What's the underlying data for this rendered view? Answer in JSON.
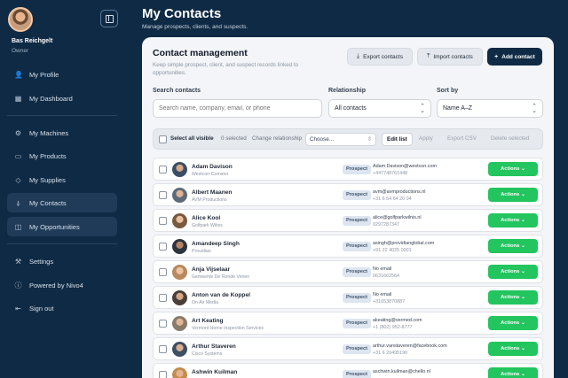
{
  "user": {
    "name": "Bas Reichgelt",
    "role": "Owner"
  },
  "sidebar": {
    "items": [
      {
        "label": "My Profile",
        "icon": "user-icon",
        "glyph": "👤"
      },
      {
        "label": "My Dashboard",
        "icon": "dashboard-icon",
        "glyph": "▦"
      },
      {
        "label": "My Machines",
        "icon": "gear-icon",
        "glyph": "⚙"
      },
      {
        "label": "My Products",
        "icon": "box-icon",
        "glyph": "▭"
      },
      {
        "label": "My Supplies",
        "icon": "diamond-icon",
        "glyph": "◇"
      },
      {
        "label": "My Contacts",
        "icon": "person-icon",
        "glyph": "⍋"
      },
      {
        "label": "My Opportunities",
        "icon": "board-icon",
        "glyph": "◫"
      },
      {
        "label": "Settings",
        "icon": "wrench-icon",
        "glyph": "⚒"
      },
      {
        "label": "Powered by Nivo4",
        "icon": "info-icon",
        "glyph": "ⓘ"
      },
      {
        "label": "Sign out",
        "icon": "sign-out-icon",
        "glyph": "⇤"
      }
    ]
  },
  "header": {
    "title": "My Contacts",
    "subtitle": "Manage prospects, clients, and suspects."
  },
  "card": {
    "title": "Contact management",
    "description": "Keep simple prospect, client, and suspect records linked to opportunities.",
    "export_label": "Export contacts",
    "import_label": "Import contacts",
    "add_label": "Add contact"
  },
  "filters": {
    "search_label": "Search contacts",
    "search_placeholder": "Search name, company, email, or phone",
    "relationship_label": "Relationship",
    "relationship_value": "All contacts",
    "sort_label": "Sort by",
    "sort_value": "Name A–Z"
  },
  "bulk": {
    "select_all": "Select all visible",
    "selected": "0 selected",
    "change_relationship": "Change relationship",
    "choose": "Choose...",
    "edit_list": "Edit list",
    "apply": "Apply",
    "export_csv": "Export CSV",
    "delete_selected": "Delete selected"
  },
  "colors": {
    "sidebar": "#0f2a44",
    "accent_green": "#22c55e",
    "badge_bg": "#dde5f0"
  },
  "contacts": [
    {
      "name": "Adam Davison",
      "company": "Westcon-Comstor",
      "relationship": "Prospect",
      "email": "Adam.Davison@westcon.com",
      "phone": "+447748761448",
      "actions": "Actions ⌄"
    },
    {
      "name": "Albert Maanen",
      "company": "AVM Productions",
      "relationship": "Prospect",
      "email": "avm@avmproductions.nl",
      "phone": "+31 6 54 64 20 04",
      "actions": "Actions ⌄"
    },
    {
      "name": "Alice Kool",
      "company": "Golfpark Wilnis",
      "relationship": "Prospect",
      "email": "alice@golfparkwilnis.nl",
      "phone": "0297287347",
      "actions": "Actions ⌄"
    },
    {
      "name": "Amandeep Singh",
      "company": "Providian",
      "relationship": "Prospect",
      "email": "asingh@providianglobal.com",
      "phone": "+91 22 4025 0001",
      "actions": "Actions ⌄"
    },
    {
      "name": "Anja Vijselaar",
      "company": "Gemeente De Ronde Venen",
      "relationship": "Prospect",
      "email": "No email",
      "phone": "0631662564",
      "actions": "Actions ⌄"
    },
    {
      "name": "Anton van de Koppel",
      "company": "On Air Media",
      "relationship": "Prospect",
      "email": "No email",
      "phone": "+31653870887",
      "actions": "Actions ⌄"
    },
    {
      "name": "Art Keating",
      "company": "Vermont Home Inspection Services",
      "relationship": "Prospect",
      "email": "akeating@vermed.com",
      "phone": "+1 (802) 952-8777",
      "actions": "Actions ⌄"
    },
    {
      "name": "Arthur Staveren",
      "company": "Cisco Systems",
      "relationship": "Prospect",
      "email": "arthur.vanstaveren@facebook.com",
      "phone": "+31 6 20495190",
      "actions": "Actions ⌄"
    },
    {
      "name": "Ashwin Kuilman",
      "company": "",
      "relationship": "Prospect",
      "email": "aschwin.kuilman@chello.nl",
      "phone": "",
      "actions": "Actions ⌄"
    }
  ]
}
